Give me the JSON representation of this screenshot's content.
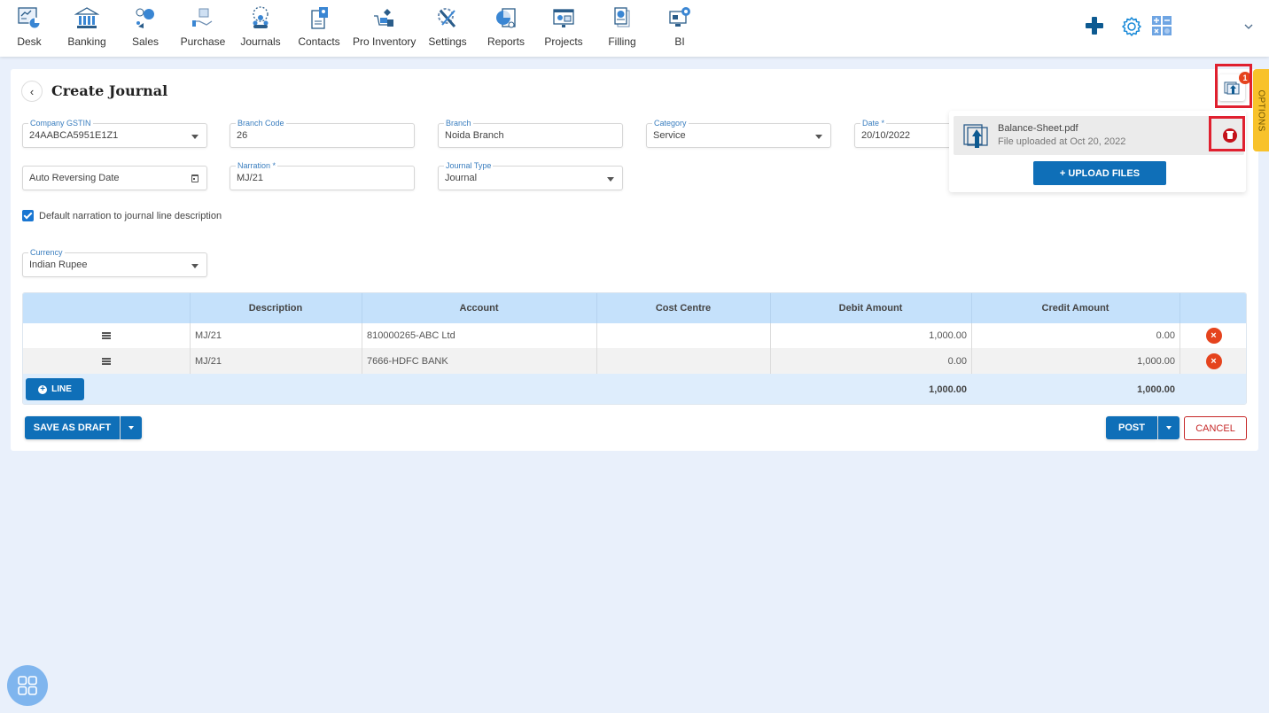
{
  "nav": {
    "items": [
      {
        "label": "Desk",
        "icon": "desk-icon"
      },
      {
        "label": "Banking",
        "icon": "bank-icon"
      },
      {
        "label": "Sales",
        "icon": "sales-icon"
      },
      {
        "label": "Purchase",
        "icon": "purchase-icon"
      },
      {
        "label": "Journals",
        "icon": "journals-icon"
      },
      {
        "label": "Contacts",
        "icon": "contacts-icon"
      },
      {
        "label": "Pro Inventory",
        "icon": "inventory-icon"
      },
      {
        "label": "Settings",
        "icon": "settings-tools-icon"
      },
      {
        "label": "Reports",
        "icon": "reports-icon"
      },
      {
        "label": "Projects",
        "icon": "projects-icon"
      },
      {
        "label": "Filling",
        "icon": "filing-icon"
      },
      {
        "label": "BI",
        "icon": "bi-icon"
      }
    ],
    "right_icons": [
      "plus-icon",
      "gear-icon",
      "calculator-icon",
      "chevron-down-icon"
    ]
  },
  "page": {
    "title": "Create Journal",
    "back_icon": "chevron-left-icon"
  },
  "form": {
    "company_gstin": {
      "label": "Company GSTIN",
      "value": "24AABCA5951E1Z1"
    },
    "branch_code": {
      "label": "Branch Code",
      "value": "26"
    },
    "branch": {
      "label": "Branch",
      "value": "Noida Branch"
    },
    "category": {
      "label": "Category",
      "value": "Service"
    },
    "date": {
      "label": "Date *",
      "value": "20/10/2022"
    },
    "auto_reversing_date": {
      "placeholder": "Auto Reversing Date"
    },
    "narration": {
      "label": "Narration *",
      "value": "MJ/21"
    },
    "journal_type": {
      "label": "Journal Type",
      "value": "Journal"
    },
    "default_narration": {
      "label": "Default narration to journal line description",
      "checked": true
    },
    "currency": {
      "label": "Currency",
      "value": "Indian Rupee"
    }
  },
  "table": {
    "headers": [
      "",
      "Description",
      "Account",
      "Cost Centre",
      "Debit Amount",
      "Credit Amount",
      ""
    ],
    "rows": [
      {
        "description": "MJ/21",
        "account": "810000265-ABC Ltd",
        "cost_centre": "",
        "debit": "1,000.00",
        "credit": "0.00"
      },
      {
        "description": "MJ/21",
        "account": "7666-HDFC BANK",
        "cost_centre": "",
        "debit": "0.00",
        "credit": "1,000.00"
      }
    ],
    "add_line_label": "LINE",
    "total_debit": "1,000.00",
    "total_credit": "1,000.00"
  },
  "actions": {
    "save_draft_label": "SAVE AS DRAFT",
    "post_label": "POST",
    "cancel_label": "CANCEL"
  },
  "attachments": {
    "count": "1",
    "files": [
      {
        "name": "Balance-Sheet.pdf",
        "meta": "File uploaded at Oct 20, 2022"
      }
    ],
    "upload_label": "+ UPLOAD FILES"
  },
  "options_tab": {
    "label": "OPTIONS"
  },
  "colors": {
    "primary": "#0f6fb8",
    "danger": "#e5431d",
    "highlight": "#e0202f",
    "options": "#f8c22b",
    "table_header": "#c5e1fb"
  }
}
